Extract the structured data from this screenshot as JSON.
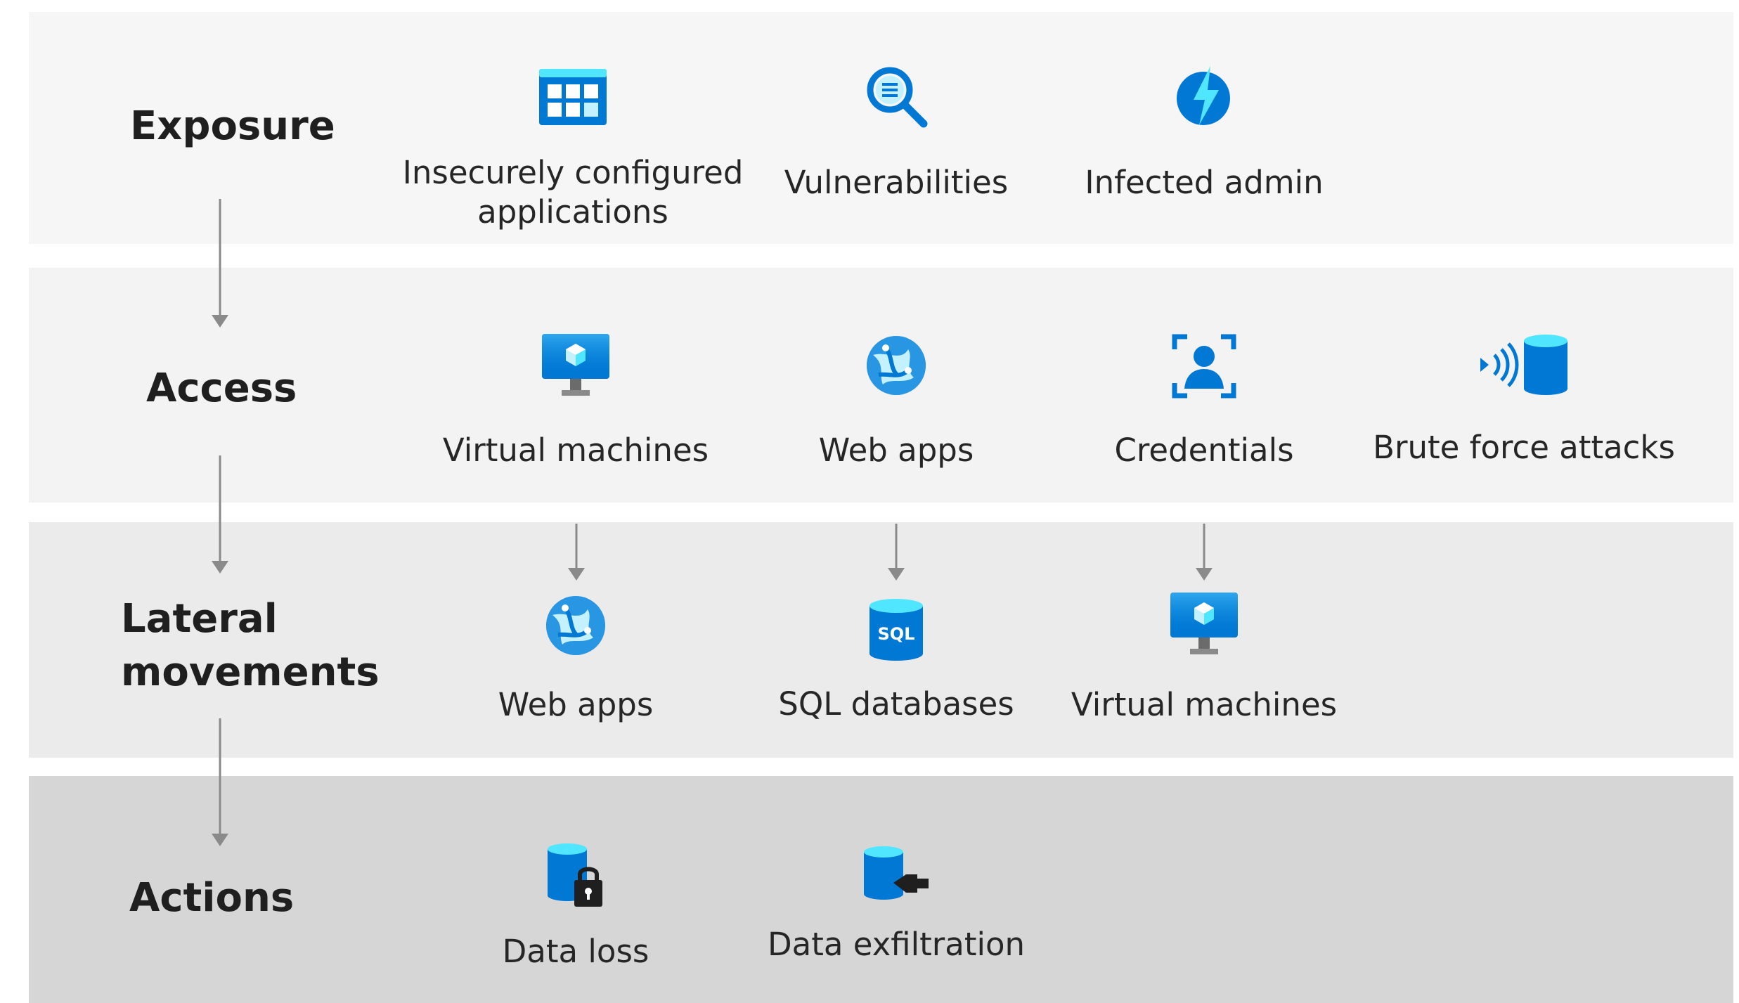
{
  "stages": {
    "exposure": {
      "label": "Exposure",
      "items": [
        {
          "caption": "Insecurely configured applications",
          "icon": "app-grid-icon"
        },
        {
          "caption": "Vulnerabilities",
          "icon": "magnifier-icon"
        },
        {
          "caption": "Infected admin",
          "icon": "lightning-icon"
        }
      ]
    },
    "access": {
      "label": "Access",
      "items": [
        {
          "caption": "Virtual machines",
          "icon": "virtual-machine-icon"
        },
        {
          "caption": "Web apps",
          "icon": "globe-icon"
        },
        {
          "caption": "Credentials",
          "icon": "user-scan-icon"
        },
        {
          "caption": "Brute force attacks",
          "icon": "database-signal-icon"
        }
      ]
    },
    "lateral": {
      "label_line1": "Lateral",
      "label_line2": "movements",
      "items": [
        {
          "caption": "Web apps",
          "icon": "globe-icon"
        },
        {
          "caption": "SQL databases",
          "icon": "sql-database-icon",
          "icon_text": "SQL"
        },
        {
          "caption": "Virtual machines",
          "icon": "virtual-machine-icon"
        }
      ]
    },
    "actions": {
      "label": "Actions",
      "items": [
        {
          "caption": "Data loss",
          "icon": "database-lock-icon"
        },
        {
          "caption": "Data exfiltration",
          "icon": "database-plug-icon"
        }
      ]
    }
  },
  "colors": {
    "icon_primary": "#0078d4",
    "icon_light": "#50e6ff",
    "arrow": "#8a8a8a",
    "text": "#262626"
  }
}
